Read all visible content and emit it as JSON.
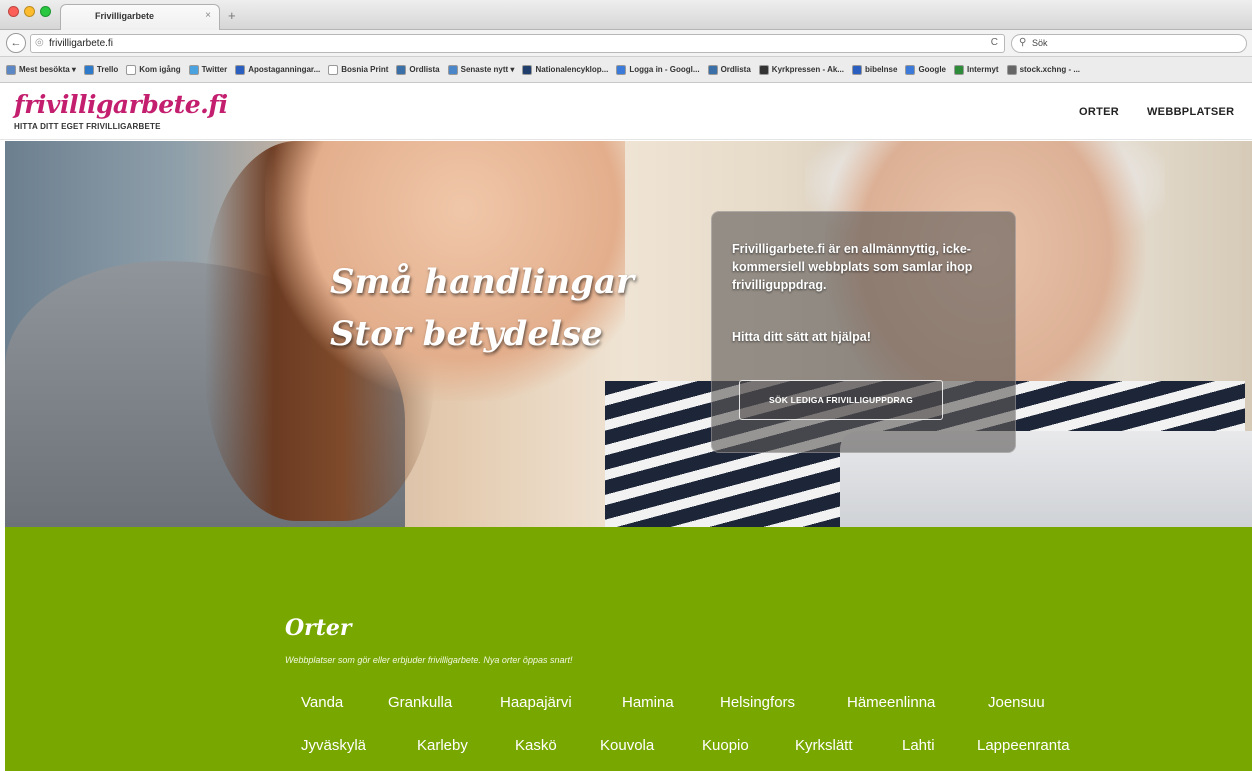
{
  "browser": {
    "tab_title": "Frivilligarbete",
    "tab_close": "×",
    "new_tab": "+",
    "url": "frivilligarbete.fi",
    "reload": "C",
    "search_placeholder": "Sök",
    "back": "←"
  },
  "bookmarks": [
    {
      "label": "Mest besökta ▾",
      "color": "#5b87c5"
    },
    {
      "label": "Trello",
      "color": "#2c7ac9"
    },
    {
      "label": "Kom igång",
      "color": "#ffffff"
    },
    {
      "label": "Twitter",
      "color": "#4aa3df"
    },
    {
      "label": "Apostaganningar...",
      "color": "#2a5fbf"
    },
    {
      "label": "Bosnia Print",
      "color": "#ffffff"
    },
    {
      "label": "Ordlista",
      "color": "#3a6fa8"
    },
    {
      "label": "Senaste nytt ▾",
      "color": "#4a86c8"
    },
    {
      "label": "Nationalencyklop...",
      "color": "#1f3e6b"
    },
    {
      "label": "Logga in - Googl...",
      "color": "#3b7ad8"
    },
    {
      "label": "Ordlista",
      "color": "#3a6fa8"
    },
    {
      "label": "Kyrkpressen - Ak...",
      "color": "#333333"
    },
    {
      "label": "bibelnse",
      "color": "#2a5fbf"
    },
    {
      "label": "Google",
      "color": "#3b7ad8"
    },
    {
      "label": "Intermyt",
      "color": "#2e8b3a"
    },
    {
      "label": "stock.xchng - ...",
      "color": "#666666"
    }
  ],
  "header": {
    "logo": "frivilligarbete.fi",
    "tagline": "HITTA DITT EGET FRIVILLIGARBETE",
    "nav": {
      "orter": "ORTER",
      "webbplatser": "WEBBPLATSER"
    }
  },
  "hero": {
    "tagline_line1": "Små handlingar",
    "tagline_line2": "Stor betydelse",
    "box_text": "Frivilligarbete.fi är en allmännyttig, icke-kommersiell webbplats som samlar ihop frivilliguppdrag.",
    "box_help": "Hitta ditt sätt att hjälpa!",
    "cta": "SÖK LEDIGA FRIVILLIGUPPDRAG"
  },
  "orter": {
    "title": "Orter",
    "subtitle": "Webbplatser som gör eller erbjuder frivilligarbete. Nya orter öppas snart!",
    "cities_row1": [
      "Vanda",
      "Grankulla",
      "Haapajärvi",
      "Hamina",
      "Helsingfors",
      "Hämeenlinna",
      "Joensuu"
    ],
    "cities_row2": [
      "Jyväskylä",
      "Karleby",
      "Kaskö",
      "Kouvola",
      "Kuopio",
      "Kyrkslätt",
      "Lahti",
      "Lappeenranta"
    ]
  },
  "colors": {
    "brand_pink": "#c41e6f",
    "section_green": "#78a800"
  }
}
